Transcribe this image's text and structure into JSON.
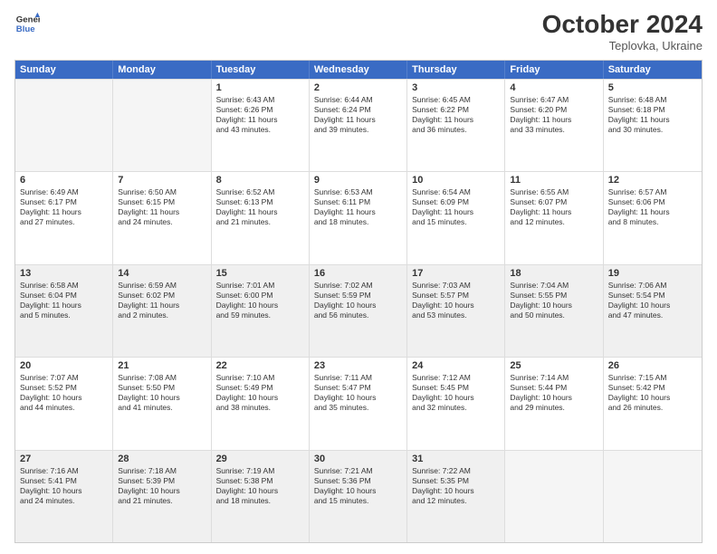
{
  "header": {
    "logo_line1": "General",
    "logo_line2": "Blue",
    "month": "October 2024",
    "location": "Teplovka, Ukraine"
  },
  "days_of_week": [
    "Sunday",
    "Monday",
    "Tuesday",
    "Wednesday",
    "Thursday",
    "Friday",
    "Saturday"
  ],
  "rows": [
    [
      {
        "day": "",
        "empty": true,
        "lines": []
      },
      {
        "day": "",
        "empty": true,
        "lines": []
      },
      {
        "day": "1",
        "lines": [
          "Sunrise: 6:43 AM",
          "Sunset: 6:26 PM",
          "Daylight: 11 hours",
          "and 43 minutes."
        ]
      },
      {
        "day": "2",
        "lines": [
          "Sunrise: 6:44 AM",
          "Sunset: 6:24 PM",
          "Daylight: 11 hours",
          "and 39 minutes."
        ]
      },
      {
        "day": "3",
        "lines": [
          "Sunrise: 6:45 AM",
          "Sunset: 6:22 PM",
          "Daylight: 11 hours",
          "and 36 minutes."
        ]
      },
      {
        "day": "4",
        "lines": [
          "Sunrise: 6:47 AM",
          "Sunset: 6:20 PM",
          "Daylight: 11 hours",
          "and 33 minutes."
        ]
      },
      {
        "day": "5",
        "lines": [
          "Sunrise: 6:48 AM",
          "Sunset: 6:18 PM",
          "Daylight: 11 hours",
          "and 30 minutes."
        ]
      }
    ],
    [
      {
        "day": "6",
        "lines": [
          "Sunrise: 6:49 AM",
          "Sunset: 6:17 PM",
          "Daylight: 11 hours",
          "and 27 minutes."
        ]
      },
      {
        "day": "7",
        "lines": [
          "Sunrise: 6:50 AM",
          "Sunset: 6:15 PM",
          "Daylight: 11 hours",
          "and 24 minutes."
        ]
      },
      {
        "day": "8",
        "lines": [
          "Sunrise: 6:52 AM",
          "Sunset: 6:13 PM",
          "Daylight: 11 hours",
          "and 21 minutes."
        ]
      },
      {
        "day": "9",
        "lines": [
          "Sunrise: 6:53 AM",
          "Sunset: 6:11 PM",
          "Daylight: 11 hours",
          "and 18 minutes."
        ]
      },
      {
        "day": "10",
        "lines": [
          "Sunrise: 6:54 AM",
          "Sunset: 6:09 PM",
          "Daylight: 11 hours",
          "and 15 minutes."
        ]
      },
      {
        "day": "11",
        "lines": [
          "Sunrise: 6:55 AM",
          "Sunset: 6:07 PM",
          "Daylight: 11 hours",
          "and 12 minutes."
        ]
      },
      {
        "day": "12",
        "lines": [
          "Sunrise: 6:57 AM",
          "Sunset: 6:06 PM",
          "Daylight: 11 hours",
          "and 8 minutes."
        ]
      }
    ],
    [
      {
        "day": "13",
        "shaded": true,
        "lines": [
          "Sunrise: 6:58 AM",
          "Sunset: 6:04 PM",
          "Daylight: 11 hours",
          "and 5 minutes."
        ]
      },
      {
        "day": "14",
        "shaded": true,
        "lines": [
          "Sunrise: 6:59 AM",
          "Sunset: 6:02 PM",
          "Daylight: 11 hours",
          "and 2 minutes."
        ]
      },
      {
        "day": "15",
        "shaded": true,
        "lines": [
          "Sunrise: 7:01 AM",
          "Sunset: 6:00 PM",
          "Daylight: 10 hours",
          "and 59 minutes."
        ]
      },
      {
        "day": "16",
        "shaded": true,
        "lines": [
          "Sunrise: 7:02 AM",
          "Sunset: 5:59 PM",
          "Daylight: 10 hours",
          "and 56 minutes."
        ]
      },
      {
        "day": "17",
        "shaded": true,
        "lines": [
          "Sunrise: 7:03 AM",
          "Sunset: 5:57 PM",
          "Daylight: 10 hours",
          "and 53 minutes."
        ]
      },
      {
        "day": "18",
        "shaded": true,
        "lines": [
          "Sunrise: 7:04 AM",
          "Sunset: 5:55 PM",
          "Daylight: 10 hours",
          "and 50 minutes."
        ]
      },
      {
        "day": "19",
        "shaded": true,
        "lines": [
          "Sunrise: 7:06 AM",
          "Sunset: 5:54 PM",
          "Daylight: 10 hours",
          "and 47 minutes."
        ]
      }
    ],
    [
      {
        "day": "20",
        "lines": [
          "Sunrise: 7:07 AM",
          "Sunset: 5:52 PM",
          "Daylight: 10 hours",
          "and 44 minutes."
        ]
      },
      {
        "day": "21",
        "lines": [
          "Sunrise: 7:08 AM",
          "Sunset: 5:50 PM",
          "Daylight: 10 hours",
          "and 41 minutes."
        ]
      },
      {
        "day": "22",
        "lines": [
          "Sunrise: 7:10 AM",
          "Sunset: 5:49 PM",
          "Daylight: 10 hours",
          "and 38 minutes."
        ]
      },
      {
        "day": "23",
        "lines": [
          "Sunrise: 7:11 AM",
          "Sunset: 5:47 PM",
          "Daylight: 10 hours",
          "and 35 minutes."
        ]
      },
      {
        "day": "24",
        "lines": [
          "Sunrise: 7:12 AM",
          "Sunset: 5:45 PM",
          "Daylight: 10 hours",
          "and 32 minutes."
        ]
      },
      {
        "day": "25",
        "lines": [
          "Sunrise: 7:14 AM",
          "Sunset: 5:44 PM",
          "Daylight: 10 hours",
          "and 29 minutes."
        ]
      },
      {
        "day": "26",
        "lines": [
          "Sunrise: 7:15 AM",
          "Sunset: 5:42 PM",
          "Daylight: 10 hours",
          "and 26 minutes."
        ]
      }
    ],
    [
      {
        "day": "27",
        "shaded": true,
        "lines": [
          "Sunrise: 7:16 AM",
          "Sunset: 5:41 PM",
          "Daylight: 10 hours",
          "and 24 minutes."
        ]
      },
      {
        "day": "28",
        "shaded": true,
        "lines": [
          "Sunrise: 7:18 AM",
          "Sunset: 5:39 PM",
          "Daylight: 10 hours",
          "and 21 minutes."
        ]
      },
      {
        "day": "29",
        "shaded": true,
        "lines": [
          "Sunrise: 7:19 AM",
          "Sunset: 5:38 PM",
          "Daylight: 10 hours",
          "and 18 minutes."
        ]
      },
      {
        "day": "30",
        "shaded": true,
        "lines": [
          "Sunrise: 7:21 AM",
          "Sunset: 5:36 PM",
          "Daylight: 10 hours",
          "and 15 minutes."
        ]
      },
      {
        "day": "31",
        "shaded": true,
        "lines": [
          "Sunrise: 7:22 AM",
          "Sunset: 5:35 PM",
          "Daylight: 10 hours",
          "and 12 minutes."
        ]
      },
      {
        "day": "",
        "empty": true,
        "lines": []
      },
      {
        "day": "",
        "empty": true,
        "lines": []
      }
    ]
  ]
}
